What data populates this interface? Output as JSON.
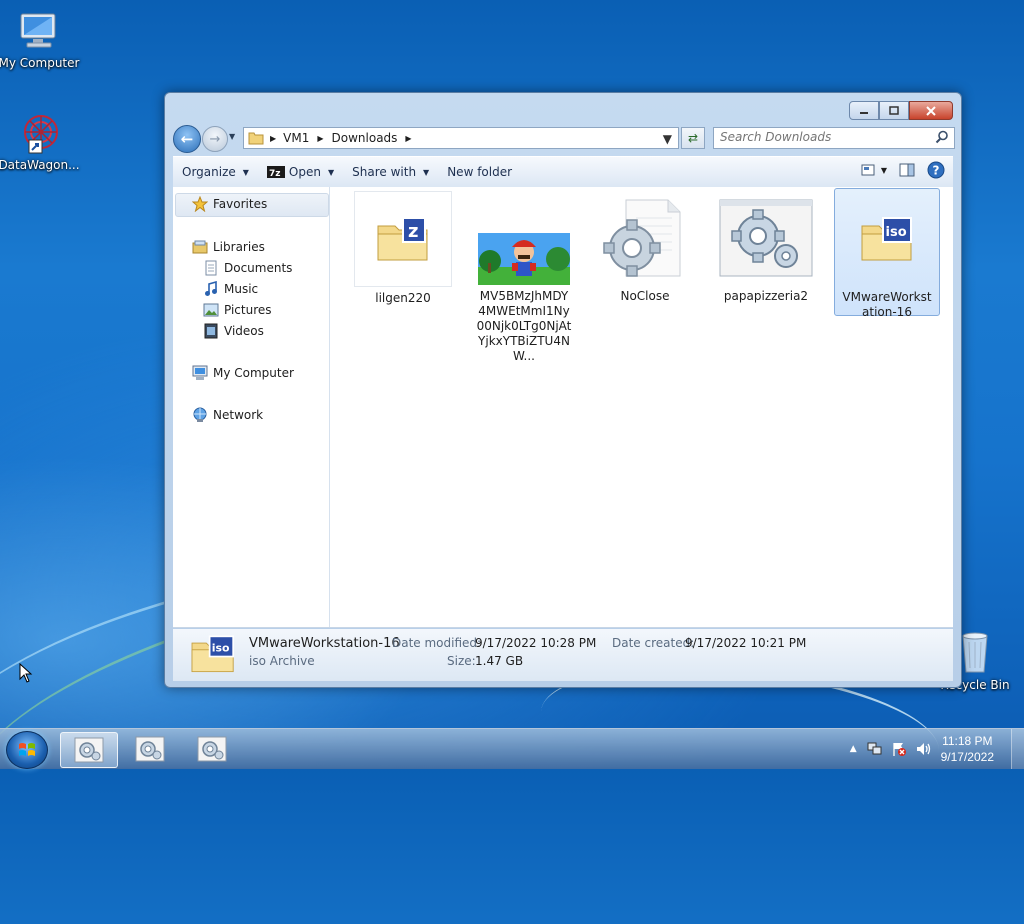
{
  "desktop": {
    "icons": [
      {
        "label": "My Computer"
      },
      {
        "label": "DataWagon..."
      },
      {
        "label": "Recycle Bin"
      }
    ]
  },
  "window": {
    "breadcrumb": [
      "VM1",
      "Downloads"
    ],
    "search_placeholder": "Search Downloads",
    "toolbar": {
      "organize": "Organize",
      "open": "Open",
      "share_with": "Share with",
      "new_folder": "New folder"
    },
    "nav": {
      "favorites": "Favorites",
      "libraries": "Libraries",
      "documents": "Documents",
      "music": "Music",
      "pictures": "Pictures",
      "videos": "Videos",
      "my_computer": "My Computer",
      "network": "Network"
    },
    "files": [
      {
        "name": "lilgen220",
        "icon": "zip-folder-icon"
      },
      {
        "name": "MV5BMzJhMDY4MWEtMmI1Ny00Njk0LTg0NjAtYjkxYTBiZTU4NW...",
        "icon": "mario-image-thumbnail"
      },
      {
        "name": "NoClose",
        "icon": "gear-document-icon"
      },
      {
        "name": "papapizzeria2",
        "icon": "gear-application-icon"
      },
      {
        "name": "VMwareWorkstation-16",
        "icon": "iso-folder-icon",
        "selected": true
      }
    ],
    "details": {
      "name": "VMwareWorkstation-16",
      "type": "iso Archive",
      "modified_label": "Date modified:",
      "modified_value": "9/17/2022 10:28 PM",
      "created_label": "Date created:",
      "created_value": "9/17/2022 10:21 PM",
      "size_label": "Size:",
      "size_value": "1.47 GB"
    }
  },
  "taskbar": {
    "time": "11:18 PM",
    "date": "9/17/2022"
  }
}
